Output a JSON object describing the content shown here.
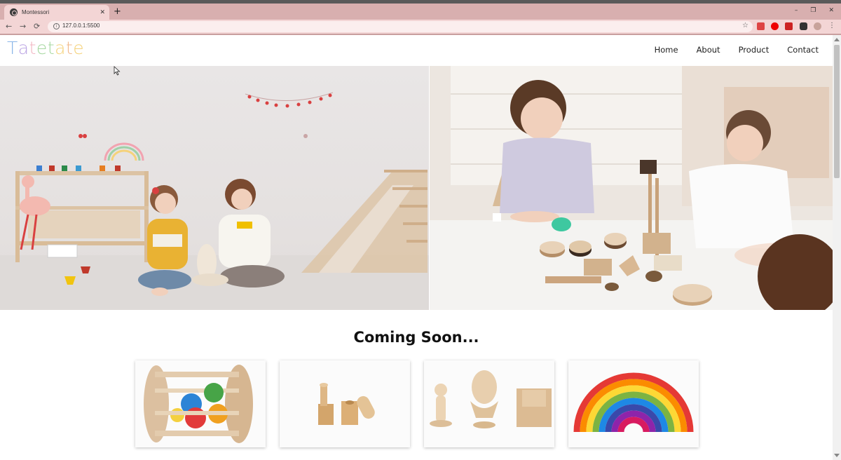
{
  "browser": {
    "tab_title": "Montessori",
    "tab_close": "✕",
    "new_tab": "+",
    "url": "127.0.0.1:5500",
    "window_controls": [
      "–",
      "❐",
      "✕"
    ],
    "back": "←",
    "forward": "→",
    "reload": "⟳",
    "bookmark": "☆",
    "info": "i"
  },
  "site": {
    "logo_letters": [
      {
        "char": "T",
        "color": "#8ab6e8"
      },
      {
        "char": "a",
        "color": "#b9a2e3"
      },
      {
        "char": "t",
        "color": "#f2b4c2"
      },
      {
        "char": "e",
        "color": "#a6d8a0"
      },
      {
        "char": "t",
        "color": "#a6d8a0"
      },
      {
        "char": "a",
        "color": "#f5d27a"
      },
      {
        "char": "t",
        "color": "#f2b88a"
      },
      {
        "char": "e",
        "color": "#f5d27a"
      }
    ],
    "nav": [
      "Home",
      "About",
      "Product",
      "Contact"
    ],
    "section_title": "Coming Soon..."
  },
  "products": [
    {
      "name": "rolling-ball-cylinder-toy"
    },
    {
      "name": "wooden-peg-blocks"
    },
    {
      "name": "egg-cup-and-box"
    },
    {
      "name": "rainbow-stacker"
    }
  ]
}
